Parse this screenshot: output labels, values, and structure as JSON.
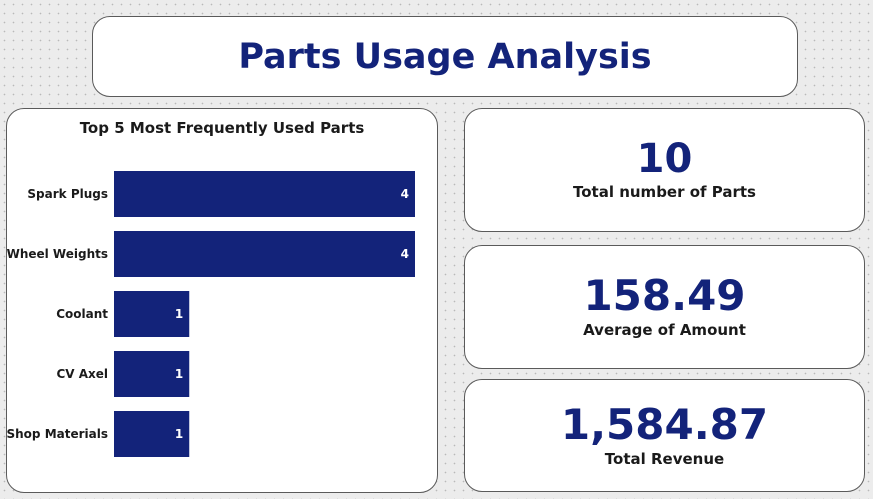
{
  "header": {
    "title": "Parts Usage Analysis"
  },
  "chart_data": {
    "type": "bar",
    "orientation": "horizontal",
    "title": "Top 5 Most Frequently Used Parts",
    "categories": [
      "Spark Plugs",
      "Wheel Weights",
      "Coolant",
      "CV Axel",
      "Shop Materials"
    ],
    "values": [
      4,
      4,
      1,
      1,
      1
    ],
    "xlim": [
      0,
      4
    ],
    "bar_color": "#13237a",
    "data_labels": true,
    "grid": false
  },
  "kpis": {
    "parts": {
      "value": "10",
      "label": "Total number of Parts"
    },
    "average": {
      "value": "158.49",
      "label": "Average of Amount"
    },
    "revenue": {
      "value": "1,584.87",
      "label": "Total Revenue"
    }
  },
  "colors": {
    "accent": "#13237a",
    "card_border": "#5a5a5a"
  }
}
